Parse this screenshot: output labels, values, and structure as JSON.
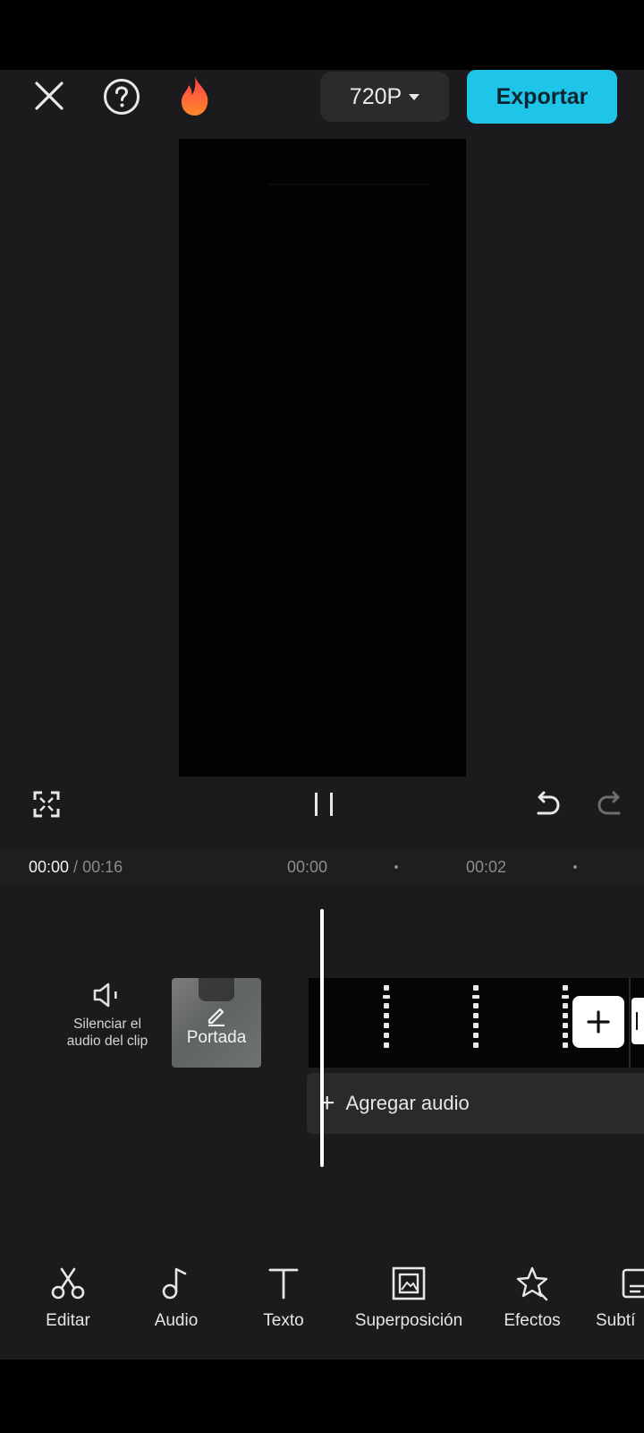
{
  "header": {
    "resolution_label": "720P",
    "export_label": "Exportar"
  },
  "timeline": {
    "current_time": "00:00",
    "separator": " / ",
    "total_time": "00:16",
    "ticks": [
      "00:00",
      "00:02"
    ],
    "mute_label_line1": "Silenciar el",
    "mute_label_line2": "audio del clip",
    "cover_label": "Portada",
    "add_audio_label": "Agregar audio"
  },
  "toolbar": {
    "items": [
      {
        "label": "Editar",
        "icon": "scissors-icon"
      },
      {
        "label": "Audio",
        "icon": "music-note-icon"
      },
      {
        "label": "Texto",
        "icon": "text-icon"
      },
      {
        "label": "Superposición",
        "icon": "overlay-icon"
      },
      {
        "label": "Efectos",
        "icon": "effects-star-icon"
      },
      {
        "label": "Subtí",
        "icon": "subtitles-icon"
      }
    ]
  },
  "colors": {
    "accent": "#1ec5e8",
    "background": "#1b1b1d"
  }
}
